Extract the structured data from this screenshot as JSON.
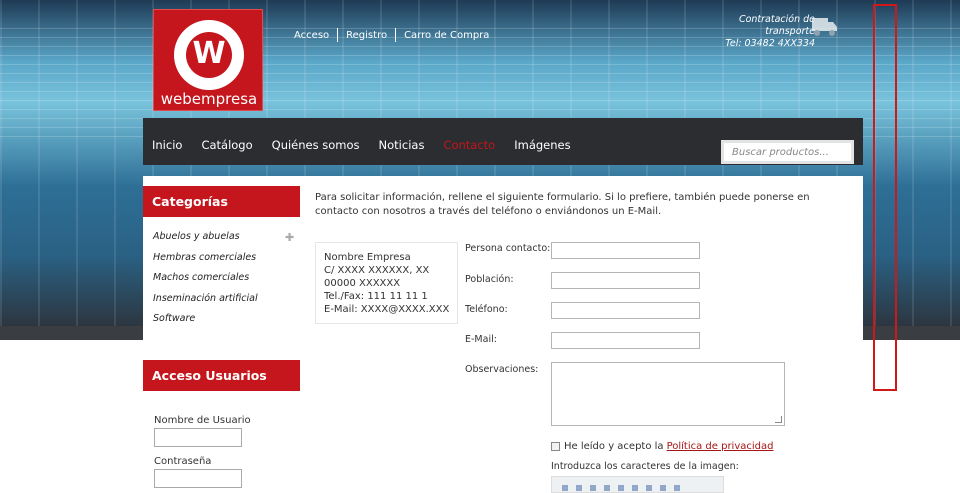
{
  "brand": {
    "name": "webempresa",
    "mark": "W"
  },
  "toplinks": [
    "Acceso",
    "Registro",
    "Carro de Compra"
  ],
  "transport": {
    "line1": "Contratación de transporte",
    "line2": "Tel: 03482 4XX334"
  },
  "nav": {
    "items": [
      "Inicio",
      "Catálogo",
      "Quiénes somos",
      "Noticias",
      "Contacto",
      "Imágenes"
    ],
    "active": "Contacto"
  },
  "search": {
    "placeholder": "Buscar productos..."
  },
  "sidebar": {
    "categories_title": "Categorías",
    "categories": [
      "Abuelos y abuelas",
      "Hembras comerciales",
      "Machos comerciales",
      "Inseminación artificial",
      "Software"
    ],
    "users_title": "Acceso Usuarios",
    "username_label": "Nombre de Usuario",
    "password_label": "Contraseña"
  },
  "intro": "Para solicitar información, rellene el siguiente formulario. Si lo prefiere, también puede ponerse en contacto con nosotros  a través del teléfono o enviándonos un E-Mail.",
  "card": {
    "line1": "Nombre Empresa",
    "line2": "C/ XXXX XXXXXX, XX",
    "line3": "00000 XXXXXX",
    "line4": "Tel./Fax: 111 11 11 1",
    "line5": "E-Mail: XXXX@XXXX.XXX"
  },
  "form": {
    "persona": "Persona contacto:",
    "poblacion": "Población:",
    "telefono": "Teléfono:",
    "email": "E-Mail:",
    "observaciones": "Observaciones:",
    "privacy_text": "He leído y acepto la",
    "privacy_link": "Política de privacidad",
    "captcha_label": "Introduzca los caracteres de la imagen:"
  }
}
